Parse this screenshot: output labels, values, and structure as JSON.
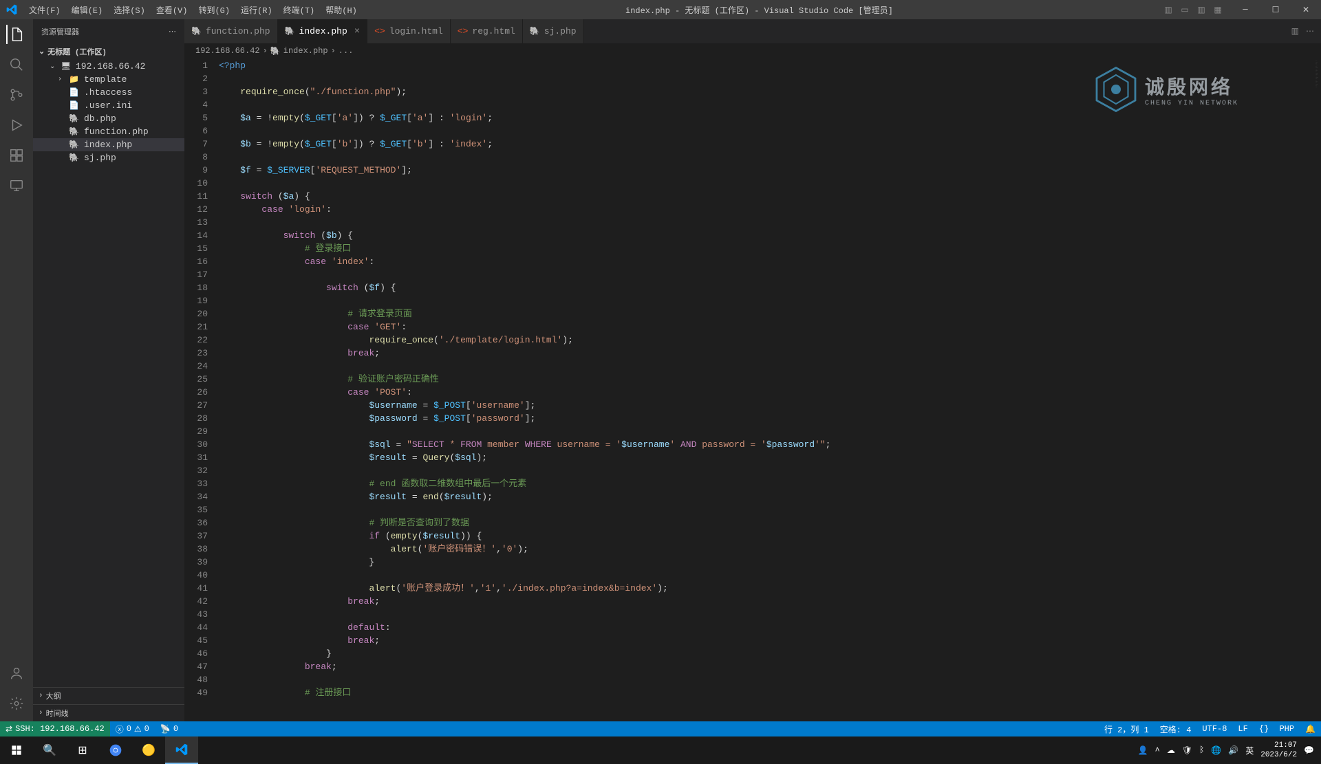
{
  "titlebar": {
    "menus": [
      "文件(F)",
      "编辑(E)",
      "选择(S)",
      "查看(V)",
      "转到(G)",
      "运行(R)",
      "终端(T)",
      "帮助(H)"
    ],
    "title": "index.php - 无标题 (工作区) - Visual Studio Code [管理员]"
  },
  "sidebar": {
    "header": "资源管理器",
    "workspace": "无标题 (工作区)",
    "root": "192.168.66.42",
    "items": [
      {
        "label": "template",
        "type": "folder",
        "indent": 1
      },
      {
        "label": ".htaccess",
        "type": "file",
        "indent": 1
      },
      {
        "label": ".user.ini",
        "type": "file",
        "indent": 1
      },
      {
        "label": "db.php",
        "type": "php",
        "indent": 1
      },
      {
        "label": "function.php",
        "type": "php",
        "indent": 1
      },
      {
        "label": "index.php",
        "type": "php",
        "indent": 1,
        "active": true
      },
      {
        "label": "sj.php",
        "type": "php",
        "indent": 1
      }
    ],
    "outline": "大纲",
    "timeline": "时间线"
  },
  "tabs": [
    {
      "label": "function.php",
      "icon": "php"
    },
    {
      "label": "index.php",
      "icon": "php",
      "active": true
    },
    {
      "label": "login.html",
      "icon": "html"
    },
    {
      "label": "reg.html",
      "icon": "html"
    },
    {
      "label": "sj.php",
      "icon": "php"
    }
  ],
  "breadcrumb": {
    "parts": [
      "192.168.66.42",
      "index.php",
      "..."
    ]
  },
  "code_lines": [
    "<span class='php-open'>&lt;?php</span>",
    "",
    "    <span class='fn'>require_once</span>(<span class='str'>\"./function.php\"</span>);",
    "",
    "    <span class='var'>$a</span> = !<span class='fn'>empty</span>(<span class='const'>$_GET</span>[<span class='str'>'a'</span>]) ? <span class='const'>$_GET</span>[<span class='str'>'a'</span>] : <span class='str'>'login'</span>;",
    "",
    "    <span class='var'>$b</span> = !<span class='fn'>empty</span>(<span class='const'>$_GET</span>[<span class='str'>'b'</span>]) ? <span class='const'>$_GET</span>[<span class='str'>'b'</span>] : <span class='str'>'index'</span>;",
    "",
    "    <span class='var'>$f</span> = <span class='const'>$_SERVER</span>[<span class='str'>'REQUEST_METHOD'</span>];",
    "",
    "    <span class='kw'>switch</span> (<span class='var'>$a</span>) {",
    "        <span class='kw'>case</span> <span class='str'>'login'</span>:",
    "",
    "            <span class='kw'>switch</span> (<span class='var'>$b</span>) {",
    "                <span class='cmt'># 登录接口</span>",
    "                <span class='kw'>case</span> <span class='str'>'index'</span>:",
    "",
    "                    <span class='kw'>switch</span> (<span class='var'>$f</span>) {",
    "",
    "                        <span class='cmt'># 请求登录页面</span>",
    "                        <span class='kw'>case</span> <span class='str'>'GET'</span>:",
    "                            <span class='fn'>require_once</span>(<span class='str'>'./template/login.html'</span>);",
    "                        <span class='kw'>break</span>;",
    "",
    "                        <span class='cmt'># 验证账户密码正确性</span>",
    "                        <span class='kw'>case</span> <span class='str'>'POST'</span>:",
    "                            <span class='var'>$username</span> = <span class='const'>$_POST</span>[<span class='str'>'username'</span>];",
    "                            <span class='var'>$password</span> = <span class='const'>$_POST</span>[<span class='str'>'password'</span>];",
    "",
    "                            <span class='var'>$sql</span> = <span class='str'>\"</span><span class='kw'>SELECT</span><span class='str'> * </span><span class='kw'>FROM</span><span class='str'> member </span><span class='kw'>WHERE</span><span class='str'> username = '</span><span class='var'>$username</span><span class='str'>' </span><span class='kw'>AND</span><span class='str'> password = '</span><span class='var'>$password</span><span class='str'>'\"</span>;",
    "                            <span class='var'>$result</span> = <span class='fn'>Query</span>(<span class='var'>$sql</span>);",
    "",
    "                            <span class='cmt'># end 函数取二维数组中最后一个元素</span>",
    "                            <span class='var'>$result</span> = <span class='fn'>end</span>(<span class='var'>$result</span>);",
    "",
    "                            <span class='cmt'># 判断是否查询到了数据</span>",
    "                            <span class='kw'>if</span> (<span class='fn'>empty</span>(<span class='var'>$result</span>)) {",
    "                                <span class='fn'>alert</span>(<span class='str'>'账户密码错误！'</span>,<span class='str'>'0'</span>);",
    "                            }",
    "",
    "                            <span class='fn'>alert</span>(<span class='str'>'账户登录成功！'</span>,<span class='str'>'1'</span>,<span class='str'>'./index.php?a=index&amp;b=index'</span>);",
    "                        <span class='kw'>break</span>;",
    "",
    "                        <span class='kw'>default</span>:",
    "                        <span class='kw'>break</span>;",
    "                    }",
    "                <span class='kw'>break</span>;",
    "",
    "                <span class='cmt'># 注册接口</span>"
  ],
  "statusbar": {
    "remote": "SSH: 192.168.66.42",
    "errors": "0",
    "warnings": "0",
    "ports": "0",
    "cursor": "行 2，列 1",
    "spaces": "空格: 4",
    "encoding": "UTF-8",
    "eol": "LF",
    "lang": "PHP",
    "right_icons": [
      "{}"
    ]
  },
  "watermark": {
    "big": "诚殷网络",
    "small": "CHENG YIN NETWORK"
  },
  "taskbar": {
    "time": "21:07",
    "date": "2023/6/2",
    "ime": "英"
  }
}
